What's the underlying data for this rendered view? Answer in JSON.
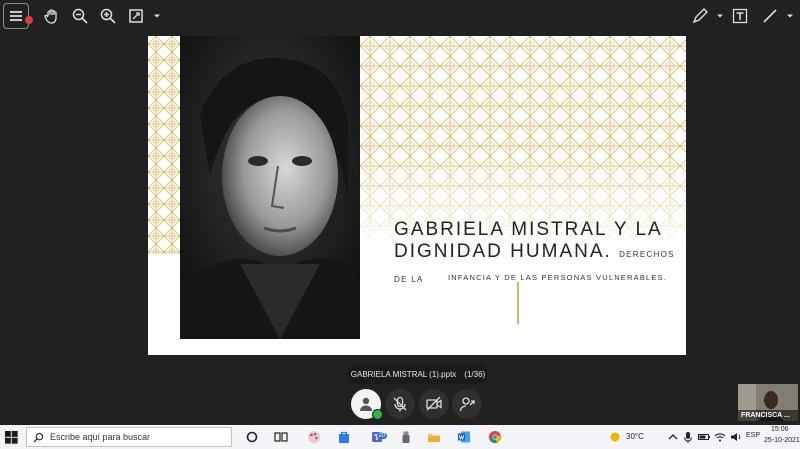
{
  "toolbar": {
    "left_tools": [
      "menu-icon",
      "hand-icon",
      "zoom-out-icon",
      "zoom-in-icon",
      "fit-page-icon"
    ],
    "right_tools": [
      "pen-icon",
      "text-box-icon",
      "line-icon"
    ]
  },
  "slide": {
    "title_main": "GABRIELA MISTRAL Y LA DIGNIDAD HUMANA.",
    "title_sub": "DERECHOS DE LA",
    "subtitle_line2": "INFANCIA Y DE LAS PERSONAS VULNERABLES.",
    "accent_color": "#d7b659"
  },
  "presentation": {
    "filename": "GABRIELA MISTRAL (1).pptx",
    "page_indicator": "(1/36)"
  },
  "participant": {
    "name": "FRANCISCA ..."
  },
  "taskbar": {
    "search_placeholder": "Escribe aquí para buscar",
    "weather": "30°C",
    "language": "ESP",
    "time": "15:06",
    "date": "25-10-2021",
    "teams_badge": "20"
  }
}
